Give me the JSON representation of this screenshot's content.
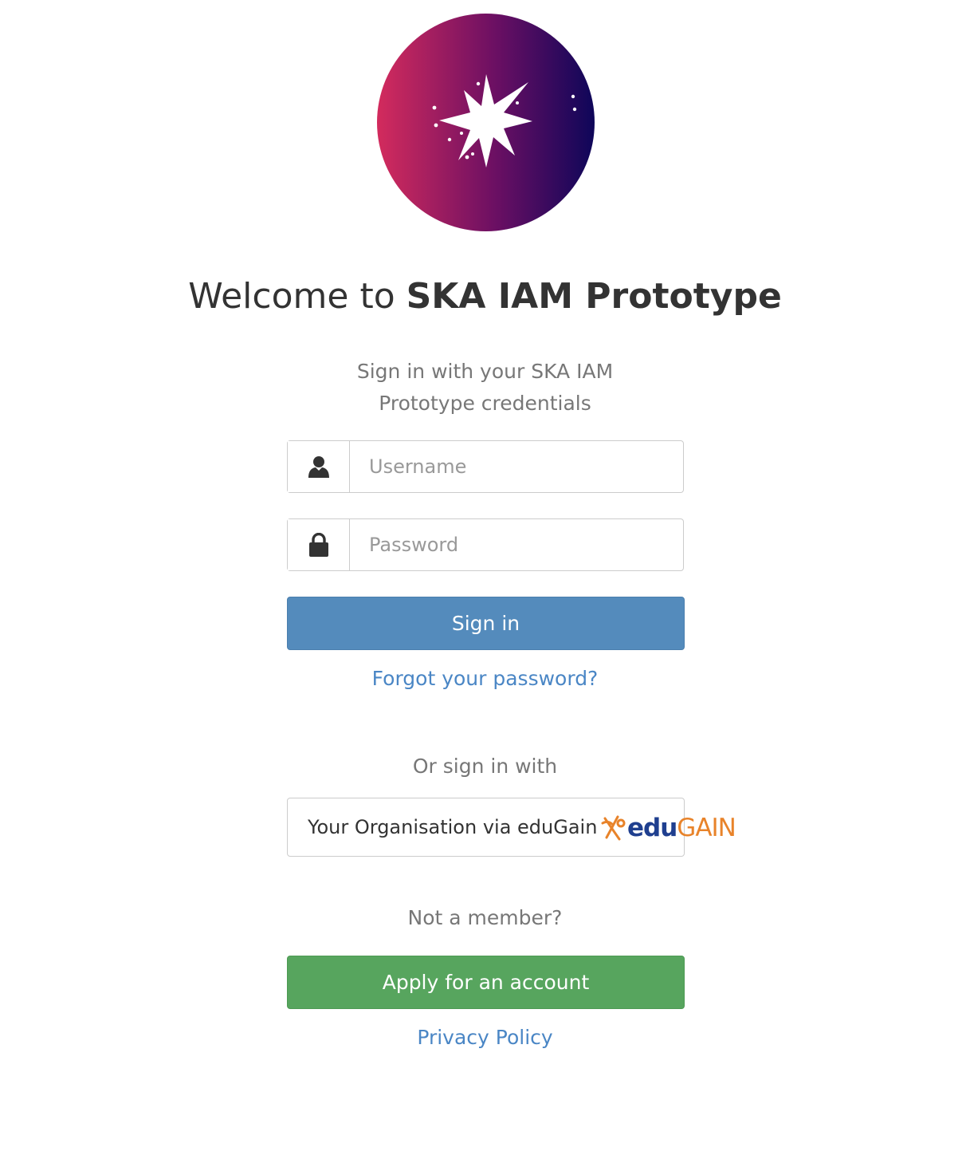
{
  "logo": {
    "icon": "ska-star-logo-icon",
    "gradient_colors": [
      "#cc2a5e",
      "#1a0a5e"
    ]
  },
  "header": {
    "welcome_prefix": "Welcome to ",
    "org_name": "SKA IAM Prototype"
  },
  "login": {
    "note": "Sign in with your SKA IAM Prototype credentials",
    "username_placeholder": "Username",
    "username_value": "",
    "username_icon": "user-icon",
    "password_placeholder": "Password",
    "password_value": "",
    "password_icon": "lock-icon",
    "signin_label": "Sign in",
    "forgot_label": "Forgot your password?"
  },
  "external": {
    "or_label": "Or sign in with",
    "edugain_label": "Your Organisation via eduGain",
    "edugain_logo_edu": "edu",
    "edugain_logo_gain": "GAIN"
  },
  "registration": {
    "not_member_label": "Not a member?",
    "apply_label": "Apply for an account",
    "privacy_label": "Privacy Policy"
  },
  "colors": {
    "primary": "#548bbc",
    "success": "#57a55e",
    "link": "#4a86c5"
  }
}
